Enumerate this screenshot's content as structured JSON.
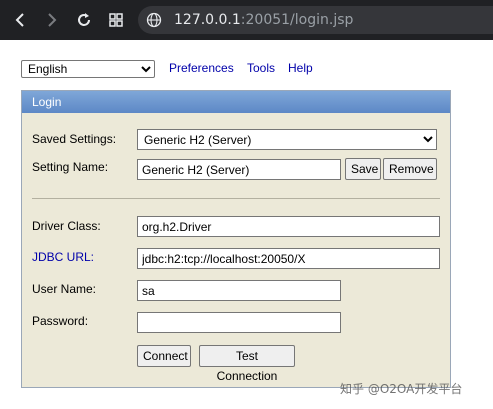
{
  "browser": {
    "url_host": "127.0.0.1",
    "url_rest": ":20051/login.jsp"
  },
  "top": {
    "language": "English",
    "preferences": "Preferences",
    "tools": "Tools",
    "help": "Help"
  },
  "login": {
    "title": "Login",
    "saved_settings_label": "Saved Settings:",
    "saved_settings_value": "Generic H2 (Server)",
    "setting_name_label": "Setting Name:",
    "setting_name_value": "Generic H2 (Server)",
    "save": "Save",
    "remove": "Remove",
    "driver_class_label": "Driver Class:",
    "driver_class_value": "org.h2.Driver",
    "jdbc_url_label": "JDBC URL:",
    "jdbc_url_value": "jdbc:h2:tcp://localhost:20050/X",
    "user_name_label": "User Name:",
    "user_name_value": "sa",
    "password_label": "Password:",
    "password_value": "",
    "connect": "Connect",
    "test_connection": "Test Connection"
  },
  "watermark": "知乎 @O2OA开发平台"
}
